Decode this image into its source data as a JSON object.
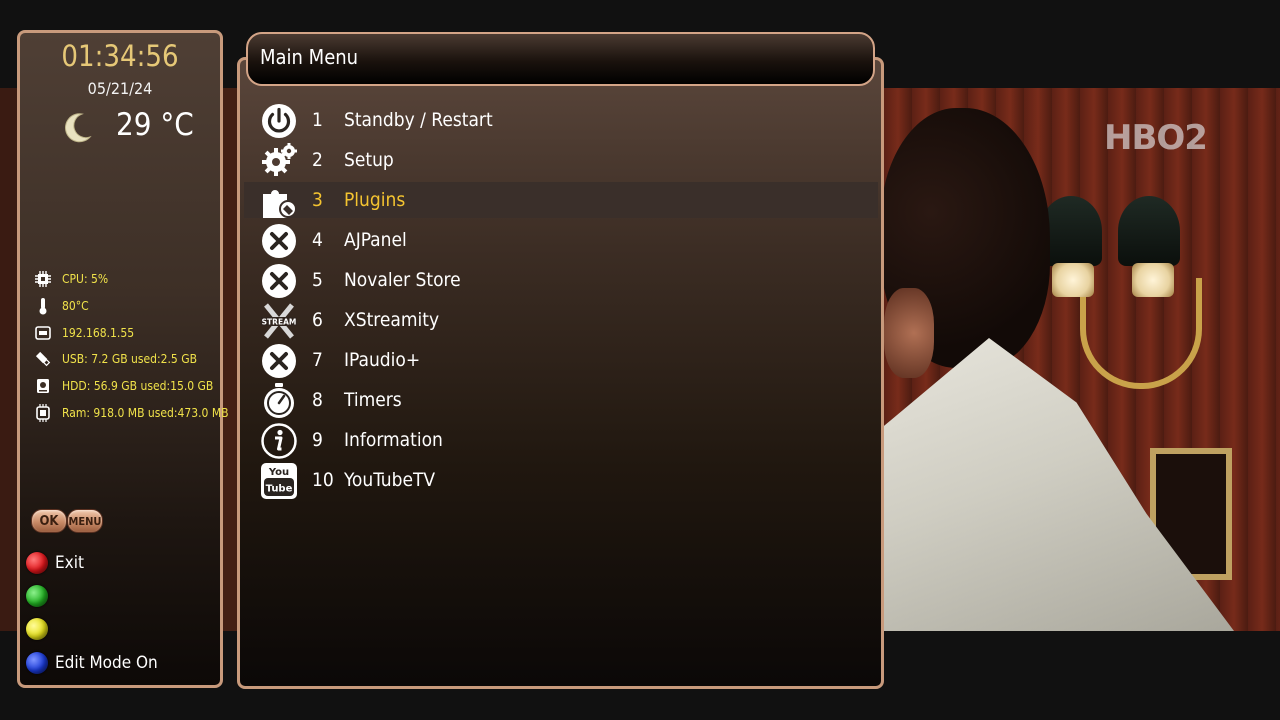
{
  "clock": {
    "time": "01:34:56",
    "date": "05/21/24"
  },
  "weather": {
    "icon": "moon-icon",
    "temperature": "29 °C"
  },
  "system_info": [
    {
      "icon": "cpu-icon",
      "text": "CPU:  5%"
    },
    {
      "icon": "thermometer-icon",
      "text": "80°C"
    },
    {
      "icon": "network-icon",
      "text": "192.168.1.55"
    },
    {
      "icon": "usb-icon",
      "text": "USB: 7.2 GB used:2.5 GB"
    },
    {
      "icon": "hdd-icon",
      "text": "HDD: 56.9 GB used:15.0 GB"
    },
    {
      "icon": "ram-icon",
      "text": "Ram: 918.0 MB used:473.0 MB"
    }
  ],
  "key_hints": {
    "ok": "OK",
    "menu": "MENU"
  },
  "color_keys": [
    {
      "color": "#e0161b",
      "name": "red",
      "label": "Exit"
    },
    {
      "color": "#22b022",
      "name": "green",
      "label": ""
    },
    {
      "color": "#e4de1a",
      "name": "yellow",
      "label": ""
    },
    {
      "color": "#1a3ad6",
      "name": "blue",
      "label": "Edit Mode On"
    }
  ],
  "menu": {
    "title": "Main Menu",
    "selected_index": 2,
    "items": [
      {
        "number": "1",
        "label": "Standby / Restart",
        "icon": "power-icon"
      },
      {
        "number": "2",
        "label": "Setup",
        "icon": "gears-icon"
      },
      {
        "number": "3",
        "label": "Plugins",
        "icon": "puzzle-icon"
      },
      {
        "number": "4",
        "label": "AJPanel",
        "icon": "x-circle-icon"
      },
      {
        "number": "5",
        "label": "Novaler Store",
        "icon": "x-circle-icon"
      },
      {
        "number": "6",
        "label": "XStreamity",
        "icon": "xstream-icon"
      },
      {
        "number": "7",
        "label": "IPaudio+",
        "icon": "x-circle-icon"
      },
      {
        "number": "8",
        "label": "Timers",
        "icon": "stopwatch-icon"
      },
      {
        "number": "9",
        "label": "Information",
        "icon": "info-icon"
      },
      {
        "number": "10",
        "label": "YouTubeTV",
        "icon": "youtube-icon"
      }
    ]
  },
  "channel_logo": "HBO2",
  "colors": {
    "selected_text": "#f4c430",
    "clock": "#e6c877",
    "stats_text": "#f0e24a",
    "panel_border": "#c89a7c"
  }
}
